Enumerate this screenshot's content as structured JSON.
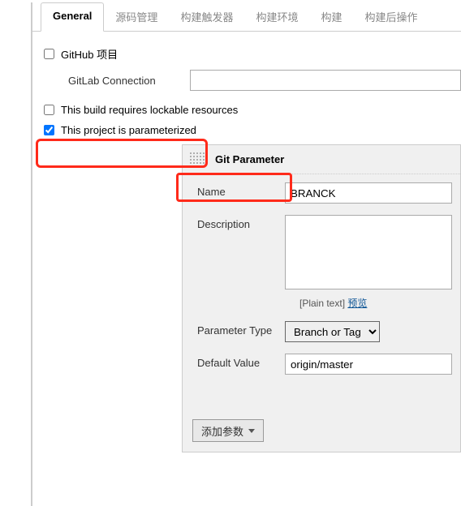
{
  "tabs": {
    "general": "General",
    "scm": "源码管理",
    "triggers": "构建触发器",
    "env": "构建环境",
    "build": "构建",
    "postBuild": "构建后操作"
  },
  "options": {
    "githubProject": "GitHub 项目",
    "gitlabConnectionLabel": "GitLab Connection",
    "gitlabConnectionValue": "",
    "lockable": "This build requires lockable resources",
    "parameterized": "This project is parameterized"
  },
  "paramPanel": {
    "title": "Git Parameter",
    "nameLabel": "Name",
    "nameValue": "BRANCK",
    "descLabel": "Description",
    "descValue": "",
    "plainText": "[Plain text]",
    "preview": "预览",
    "typeLabel": "Parameter Type",
    "typeValue": "Branch or Tag",
    "defaultLabel": "Default Value",
    "defaultValue": "origin/master",
    "addParam": "添加参数"
  }
}
